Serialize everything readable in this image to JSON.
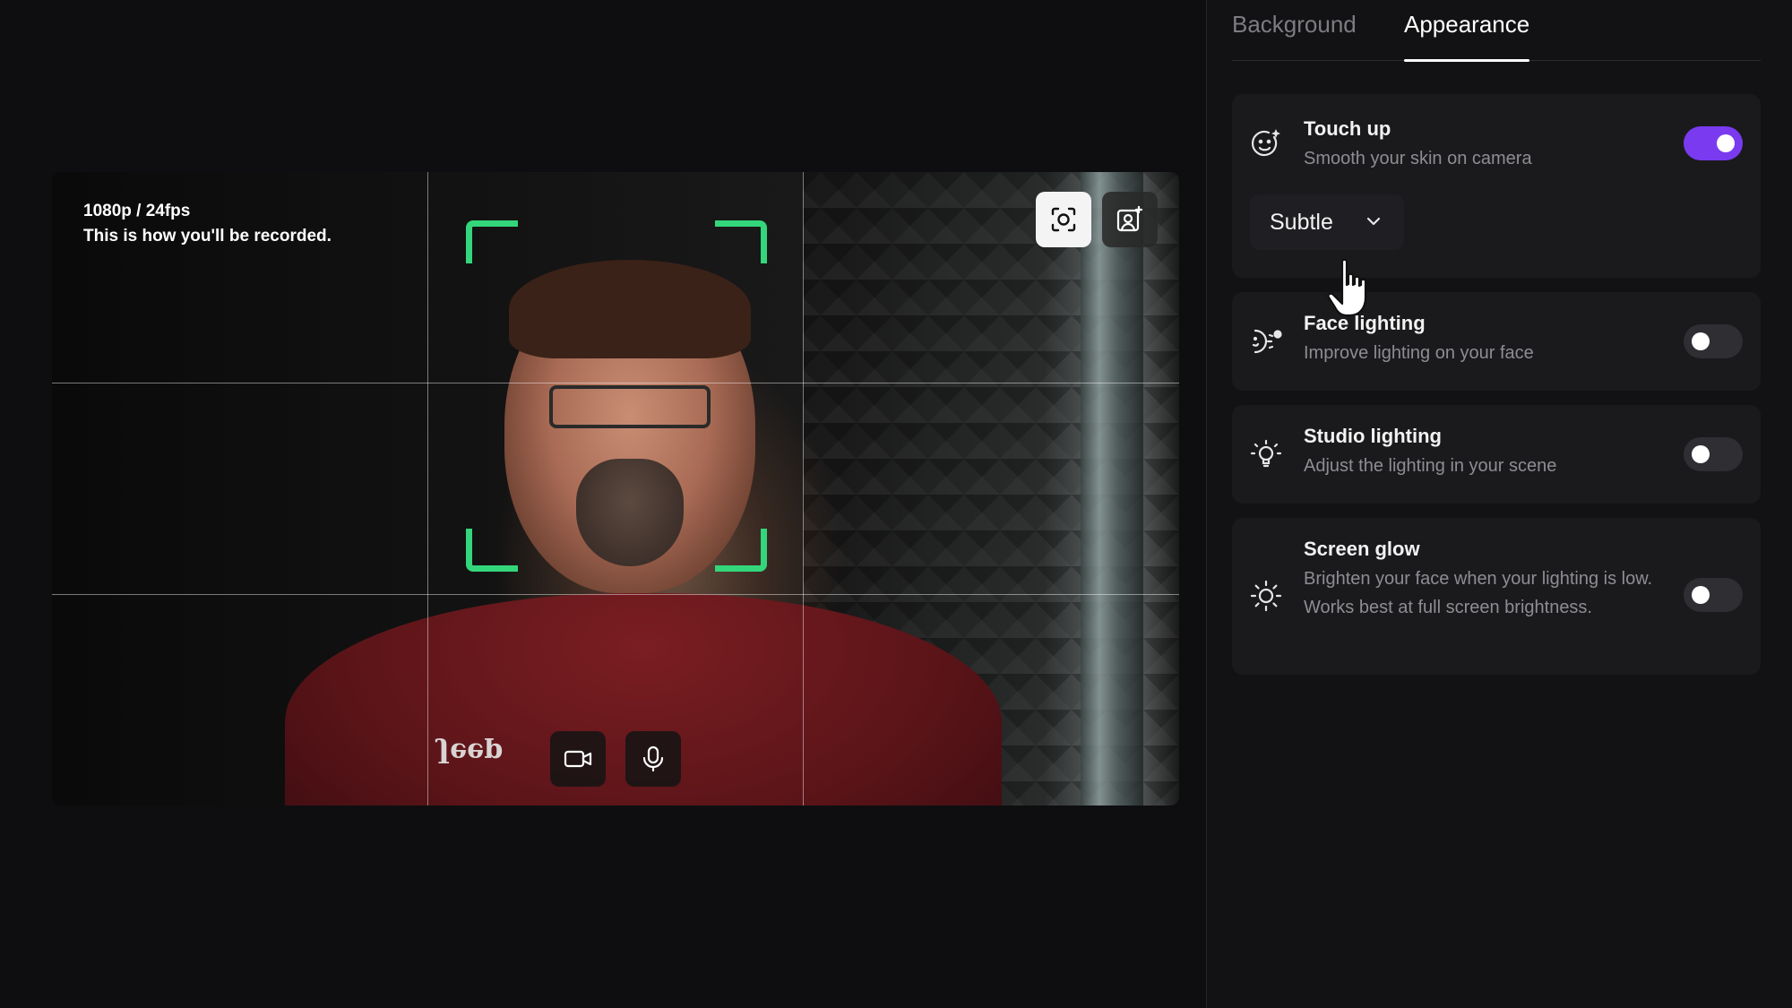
{
  "preview": {
    "resolution": "1080p / 24fps",
    "note": "This is how you'll be recorded.",
    "shirt_logo": "Jeep",
    "frame_color": "#33d67a"
  },
  "tabs": [
    {
      "label": "Background",
      "active": false
    },
    {
      "label": "Appearance",
      "active": true
    }
  ],
  "settings": {
    "touch_up": {
      "title": "Touch up",
      "subtitle": "Smooth your skin on camera",
      "enabled": true,
      "level": "Subtle",
      "icon": "smile-sparkle-icon"
    },
    "face_lighting": {
      "title": "Face lighting",
      "subtitle": "Improve lighting on your face",
      "enabled": false,
      "icon": "face-light-icon"
    },
    "studio_lighting": {
      "title": "Studio lighting",
      "subtitle": "Adjust the lighting in your scene",
      "enabled": false,
      "icon": "lightbulb-icon"
    },
    "screen_glow": {
      "title": "Screen glow",
      "subtitle": "Brighten your face when your lighting is low. Works best at full screen brightness.",
      "enabled": false,
      "icon": "sun-icon"
    }
  },
  "colors": {
    "accent": "#7a3bf0",
    "panel_bg": "#121214",
    "card_bg": "#1a1a1d"
  }
}
